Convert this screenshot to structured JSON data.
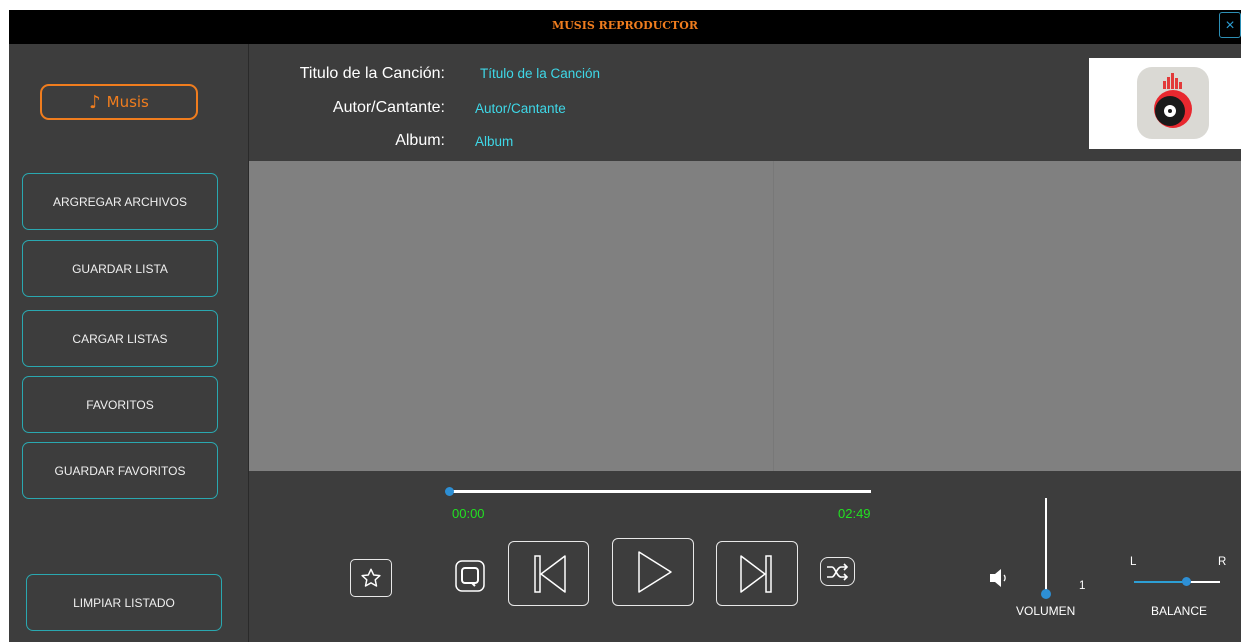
{
  "window": {
    "title": "MUSIS REPRODUCTOR",
    "close_icon": "×"
  },
  "sidebar": {
    "logo_text": "Musis",
    "buttons": [
      "ARGREGAR ARCHIVOS",
      "GUARDAR LISTA",
      "CARGAR LISTAS",
      "FAVORITOS",
      "GUARDAR FAVORITOS"
    ],
    "clear_button": "LIMPIAR LISTADO"
  },
  "track": {
    "title_label": "Titulo de la Canción:",
    "title_value": "Título de la Canción",
    "artist_label": "Autor/Cantante:",
    "artist_value": "Autor/Cantante",
    "album_label": "Album:",
    "album_value": "Album"
  },
  "player": {
    "current_time": "00:00",
    "total_time": "02:49",
    "progress": 0,
    "volume_value": "1",
    "volume_label": "VOLUMEN",
    "volume_level": 0.0,
    "balance_left": "L",
    "balance_right": "R",
    "balance_label": "BALANCE",
    "balance_value": 0.6
  },
  "colors": {
    "accent_orange": "#f07d1e",
    "accent_cyan": "#3ed8e8",
    "time_green": "#22e022",
    "thumb_blue": "#2d8fd5"
  },
  "icons": [
    "music-note-icon",
    "star-icon",
    "repeat-icon",
    "previous-icon",
    "play-icon",
    "next-icon",
    "shuffle-icon",
    "speaker-icon",
    "close-icon",
    "album-cover-icon"
  ]
}
